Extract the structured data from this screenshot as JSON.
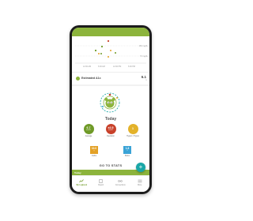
{
  "colors": {
    "brand_green": "#8cb43c",
    "fab_teal": "#1aa7a7",
    "average_green": "#6f9a27",
    "deviation_red": "#c8412a",
    "hypers_yellow": "#e3b22a",
    "carbs_orange": "#e3a126",
    "bolus_blue": "#3aa3d6"
  },
  "chart": {
    "x_ticks": [
      "12:00 AM",
      "6:00 AM",
      "12:00 PM",
      "6:00 PM"
    ],
    "ref_high": "180 mg/dL",
    "ref_low": "70 mg/dL"
  },
  "a1c": {
    "label": "Estimated A1c",
    "value": "6.1",
    "unit": "%"
  },
  "today": {
    "title": "Today",
    "stats": [
      {
        "value": "6.7",
        "unit": "mmol/L",
        "label": "Average"
      },
      {
        "value": "±2.5",
        "unit": "mmol/L",
        "label": "Deviation"
      },
      {
        "value": "1",
        "unit": "",
        "label": "Hypers / Hypos"
      }
    ],
    "squares": [
      {
        "value": "10.0",
        "unit": "g",
        "label": "Carbs"
      },
      {
        "value": "1.8",
        "unit": "U",
        "label": "Bolus"
      }
    ]
  },
  "go_to_stats": "GO TO STATS",
  "fab": "+",
  "today_bar": "Today",
  "nav": [
    {
      "icon": "logbook-icon",
      "label": "My Logbook"
    },
    {
      "icon": "report-icon",
      "label": "Report"
    },
    {
      "icon": "connections-icon",
      "label": "Connections"
    },
    {
      "icon": "more-icon",
      "label": "More"
    }
  ]
}
